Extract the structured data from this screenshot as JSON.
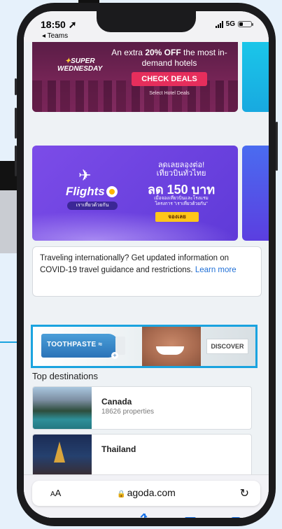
{
  "status_bar": {
    "time": "18:50",
    "back_app": "◂ Teams",
    "network": "5G"
  },
  "promo_banner_1": {
    "badge_line1": "SUPER",
    "badge_line2": "WEDNESDAY",
    "headline_prefix": "An extra ",
    "headline_bold": "20% OFF",
    "headline_suffix": " the most in-demand hotels",
    "button_label": "CHECK DEALS",
    "subtext": "Select Hotel Deals"
  },
  "promo_banner_2": {
    "logo_text": "Flights",
    "pill_text": "เราเที่ยวด้วยกัน",
    "line1": "ลดเลยลองต่อ!",
    "line2": "เที่ยวบินทั่วไทย",
    "price": "ลด 150 บาท",
    "small1": "เมื่อจองเที่ยวบินและโรงแรม",
    "small2": "โครงการ \"เราเที่ยวด้วยกัน\"",
    "button_label": "จองเลย"
  },
  "covid_notice": {
    "text": "Traveling internationally? Get updated information on COVID-19 travel guidance and restrictions.",
    "link_text": "Learn more"
  },
  "ad_banner": {
    "product_text": "TOOTHPASTE",
    "button_label": "DISCOVER"
  },
  "top_destinations": {
    "title": "Top destinations",
    "items": [
      {
        "name": "Canada",
        "count": "18626 properties"
      },
      {
        "name": "Thailand",
        "count": ""
      }
    ]
  },
  "safari": {
    "text_size_label": "AA",
    "domain": "agoda.com"
  },
  "colors": {
    "accent_blue": "#1a73e8",
    "highlight_border": "#1aa3df",
    "deal_button": "#e62e5c",
    "book_button": "#ffc61a"
  }
}
